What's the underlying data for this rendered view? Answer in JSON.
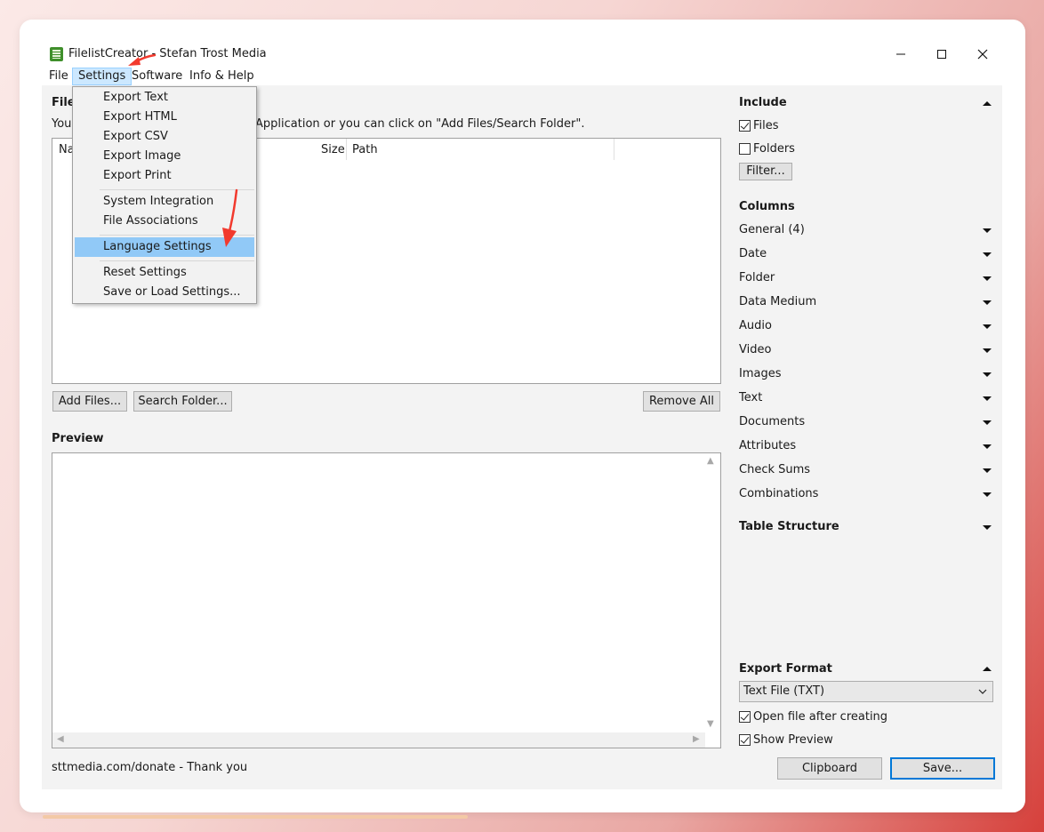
{
  "window": {
    "title": "FilelistCreator - Stefan Trost Media"
  },
  "menubar": {
    "items": [
      "File",
      "Settings",
      "Software",
      "Info & Help"
    ]
  },
  "settings_menu": {
    "groups": [
      [
        "Export Text",
        "Export HTML",
        "Export CSV",
        "Export Image",
        "Export Print"
      ],
      [
        "System Integration",
        "File Associations"
      ],
      [
        "Language Settings"
      ],
      [
        "Reset Settings",
        "Save or Load Settings..."
      ]
    ],
    "highlighted": "Language Settings"
  },
  "files_section": {
    "title_visible": "File",
    "hint_left": "You",
    "hint_right": "Application or you can click on \"Add Files/Search Folder\".",
    "columns": {
      "name": "Na",
      "size": "Size",
      "path": "Path"
    },
    "buttons": {
      "add_files": "Add Files...",
      "search_folder": "Search Folder...",
      "remove_all": "Remove All"
    }
  },
  "preview": {
    "title": "Preview"
  },
  "footer": {
    "donate_text": "sttmedia.com/donate - Thank you"
  },
  "include": {
    "title": "Include",
    "files_label": "Files",
    "files_checked": true,
    "folders_label": "Folders",
    "folders_checked": false,
    "filter_button": "Filter..."
  },
  "columns_section": {
    "title": "Columns",
    "items": [
      "General (4)",
      "Date",
      "Folder",
      "Data Medium",
      "Audio",
      "Video",
      "Images",
      "Text",
      "Documents",
      "Attributes",
      "Check Sums",
      "Combinations"
    ]
  },
  "table_structure": {
    "title": "Table Structure"
  },
  "export_format": {
    "title": "Export Format",
    "selected": "Text File (TXT)",
    "open_after_label": "Open file after creating",
    "open_after_checked": true,
    "show_preview_label": "Show Preview",
    "show_preview_checked": true,
    "clipboard_button": "Clipboard",
    "save_button": "Save..."
  },
  "colors": {
    "annotation_arrow": "#f23a2e",
    "highlight": "#91c9f7",
    "menu_active": "#cce8ff",
    "app_icon": "#3f8f2b"
  }
}
